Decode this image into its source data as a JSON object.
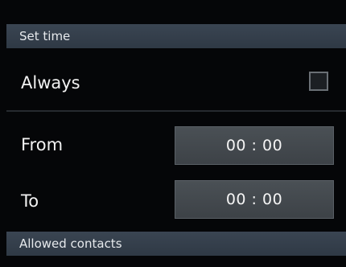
{
  "sections": {
    "set_time_title": "Set time",
    "allowed_contacts_title": "Allowed contacts"
  },
  "always": {
    "label": "Always",
    "checked": false
  },
  "from": {
    "label": "From",
    "value": "00 : 00"
  },
  "to": {
    "label": "To",
    "value": "00 : 00"
  },
  "colors": {
    "background": "#050608",
    "section_header": "#333d49",
    "field_background": "#44494e",
    "text": "#f2f2f2"
  }
}
